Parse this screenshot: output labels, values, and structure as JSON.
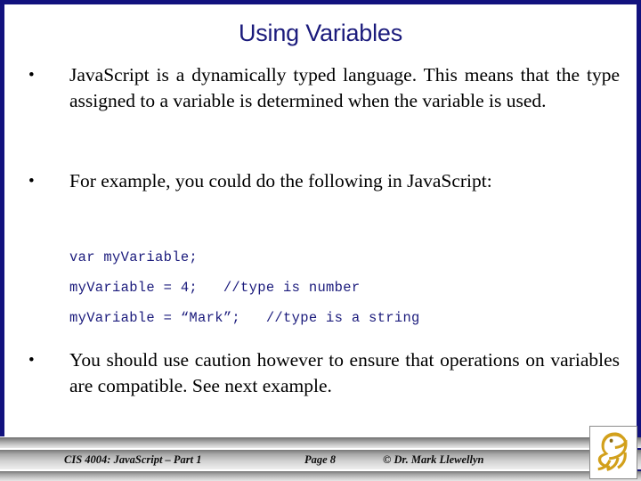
{
  "slide": {
    "title": "Using Variables",
    "title_color": "#1b1b7c",
    "border_color": "#12127e",
    "background": "#ffffff",
    "bullet_glyph": "•",
    "bullets": [
      {
        "id": "bullet-dynamic-typing",
        "text": "JavaScript is a dynamically typed language.  This means that the type assigned to a variable is determined when the variable is used."
      },
      {
        "id": "bullet-for-example",
        "text": "For example, you could do the following in JavaScript:"
      },
      {
        "id": "bullet-caution",
        "text": "You should use caution however to ensure that operations on variables are compatible. See next example."
      }
    ],
    "code": {
      "color": "#1b1b7c",
      "lines": [
        "var myVariable;",
        "myVariable = 4;   //type is number",
        "myVariable = “Mark”;   //type is a string"
      ]
    },
    "footer": {
      "course": "CIS 4004: JavaScript – Part 1",
      "page": "Page 8",
      "copyright": "© Dr. Mark Llewellyn",
      "logo_color": "#d2a01b",
      "logo_name": "ucf-pegasus-logo"
    }
  }
}
